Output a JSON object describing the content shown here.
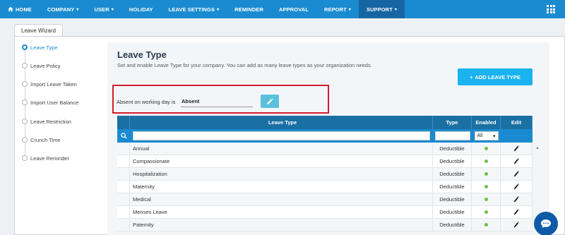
{
  "nav": {
    "items": [
      {
        "label": "HOME",
        "icon": "home-icon",
        "caret": false,
        "active": false
      },
      {
        "label": "COMPANY",
        "caret": true,
        "active": false
      },
      {
        "label": "USER",
        "caret": true,
        "active": false
      },
      {
        "label": "HOLIDAY",
        "caret": false,
        "active": false
      },
      {
        "label": "LEAVE SETTINGS",
        "caret": true,
        "active": false
      },
      {
        "label": "REMINDER",
        "caret": false,
        "active": false
      },
      {
        "label": "APPROVAL",
        "caret": false,
        "active": false
      },
      {
        "label": "REPORT",
        "caret": true,
        "active": false
      },
      {
        "label": "SUPPORT",
        "caret": true,
        "active": true
      }
    ],
    "caret_glyph": "▾",
    "apps_icon": "grid-icon"
  },
  "wizard": {
    "tab_label": "Leave Wizard",
    "steps": [
      {
        "label": "Leave Type",
        "active": true
      },
      {
        "label": "Leave Policy",
        "active": false
      },
      {
        "label": "Import Leave Taken",
        "active": false
      },
      {
        "label": "Import User Balance",
        "active": false
      },
      {
        "label": "Leave Restriction",
        "active": false
      },
      {
        "label": "Crunch Time",
        "active": false
      },
      {
        "label": "Leave Reminder",
        "active": false
      }
    ]
  },
  "main": {
    "title": "Leave Type",
    "subtitle": "Set and enable Leave Type for your company. You can add as many leave types as your organization needs.",
    "add_button": "ADD LEAVE TYPE",
    "add_button_icon": "+",
    "absent_label": "Absent on working day is",
    "absent_value": "Absent"
  },
  "table": {
    "columns": [
      "Leave Type",
      "Type",
      "Enabled",
      "Edit"
    ],
    "filter": {
      "search_value": "",
      "type_value": "",
      "enabled_select": "All"
    },
    "rows": [
      {
        "name": "Annual",
        "type": "Deductible",
        "enabled": true
      },
      {
        "name": "Compassionate",
        "type": "Deductible",
        "enabled": true
      },
      {
        "name": "Hospitalization",
        "type": "Deductible",
        "enabled": true
      },
      {
        "name": "Maternity",
        "type": "Deductible",
        "enabled": true
      },
      {
        "name": "Medical",
        "type": "Deductible",
        "enabled": true
      },
      {
        "name": "Menses Leave",
        "type": "Deductible",
        "enabled": true
      },
      {
        "name": "Paternity",
        "type": "Deductible",
        "enabled": true
      }
    ]
  },
  "colors": {
    "nav_bg": "#1a8bd0",
    "nav_active": "#1566a3",
    "accent": "#1ab3f0",
    "table_header": "#1a6fa3",
    "enabled_dot": "#6cc04a",
    "highlight_border": "#d0202a"
  }
}
